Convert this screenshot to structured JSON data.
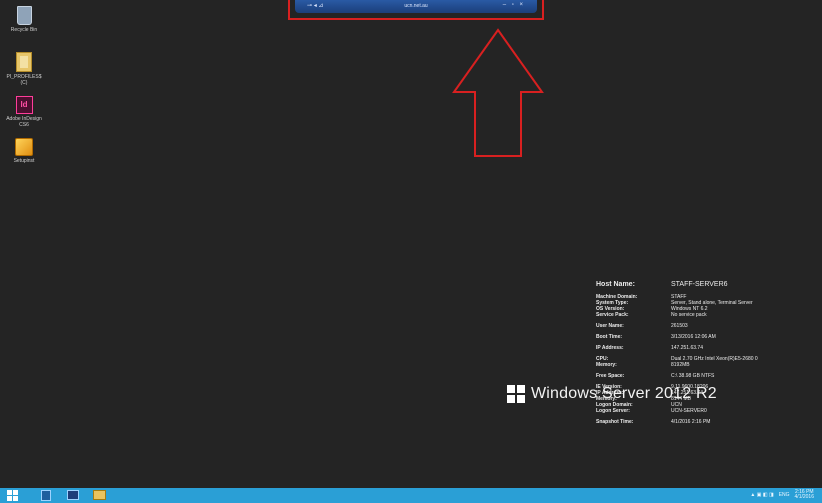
{
  "desktop": {
    "icons": [
      {
        "label": "Recycle Bin",
        "icon": "recycle-bin-icon"
      },
      {
        "label": "PI_PROFILES$ (C)",
        "icon": "folder-icon"
      },
      {
        "label": "Adobe InDesign CS6",
        "icon": "indesign-icon"
      },
      {
        "label": "Setupinst",
        "icon": "setup-icon"
      }
    ]
  },
  "connection_bar": {
    "title": "ucn.net.au",
    "highlight_color": "#d82020",
    "pin_glyph": "⊸ ◂ ⊿",
    "controls_glyph": "– ▫ ×"
  },
  "bginfo": {
    "host_label": "Host Name:",
    "host_value": "STAFF-SERVER6",
    "domain_label": "Machine Domain:",
    "domain_value": "STAFF",
    "systype_label": "System Type:",
    "systype_value": "Server, Stand alone, Terminal Server",
    "os_label": "OS Version:",
    "os_value": "Windows NT 6.2",
    "sp_label": "Service Pack:",
    "sp_value": "No service pack",
    "user_label": "User Name:",
    "user_value": "261503",
    "boot_label": "Boot Time:",
    "boot_value": "3/13/2016 12:06 AM",
    "ip_label": "IP Address:",
    "ip_value": "147.251.63.74",
    "cpu_label": "CPU:",
    "cpu_value": "Dual 2.70 GHz Intel Xeon(R)E5-2680 0",
    "mem_label": "Memory:",
    "mem_value": "8192MB",
    "free_label": "Free Space:",
    "free_value": "C:\\ 38.98 GB NTFS",
    "ie_label": "IE Version:",
    "ie_value": "9.11.9600.18206",
    "ip2_label": "IP Address:",
    "ip2_value": "147.251.63.74",
    "mem2_label": "Memory:",
    "mem2_value": "8144 MB",
    "ldomain_label": "Logon Domain:",
    "ldomain_value": "UCN",
    "lserver_label": "Logon Server:",
    "lserver_value": "UCN-SERVER0",
    "snap_label": "Snapshot Time:",
    "snap_value": "4/1/2016 2:16 PM"
  },
  "windows_branding": {
    "text": "Windows Server 2012 R2"
  },
  "taskbar": {
    "color": "#2a9fd6",
    "apps": [
      "start-icon",
      "server-manager-icon",
      "powershell-icon",
      "file-explorer-icon"
    ],
    "tray_icons": "▲ ▣ ◧ ◨",
    "lang": "ENG",
    "time": "2:16 PM",
    "date": "4/1/2016"
  }
}
